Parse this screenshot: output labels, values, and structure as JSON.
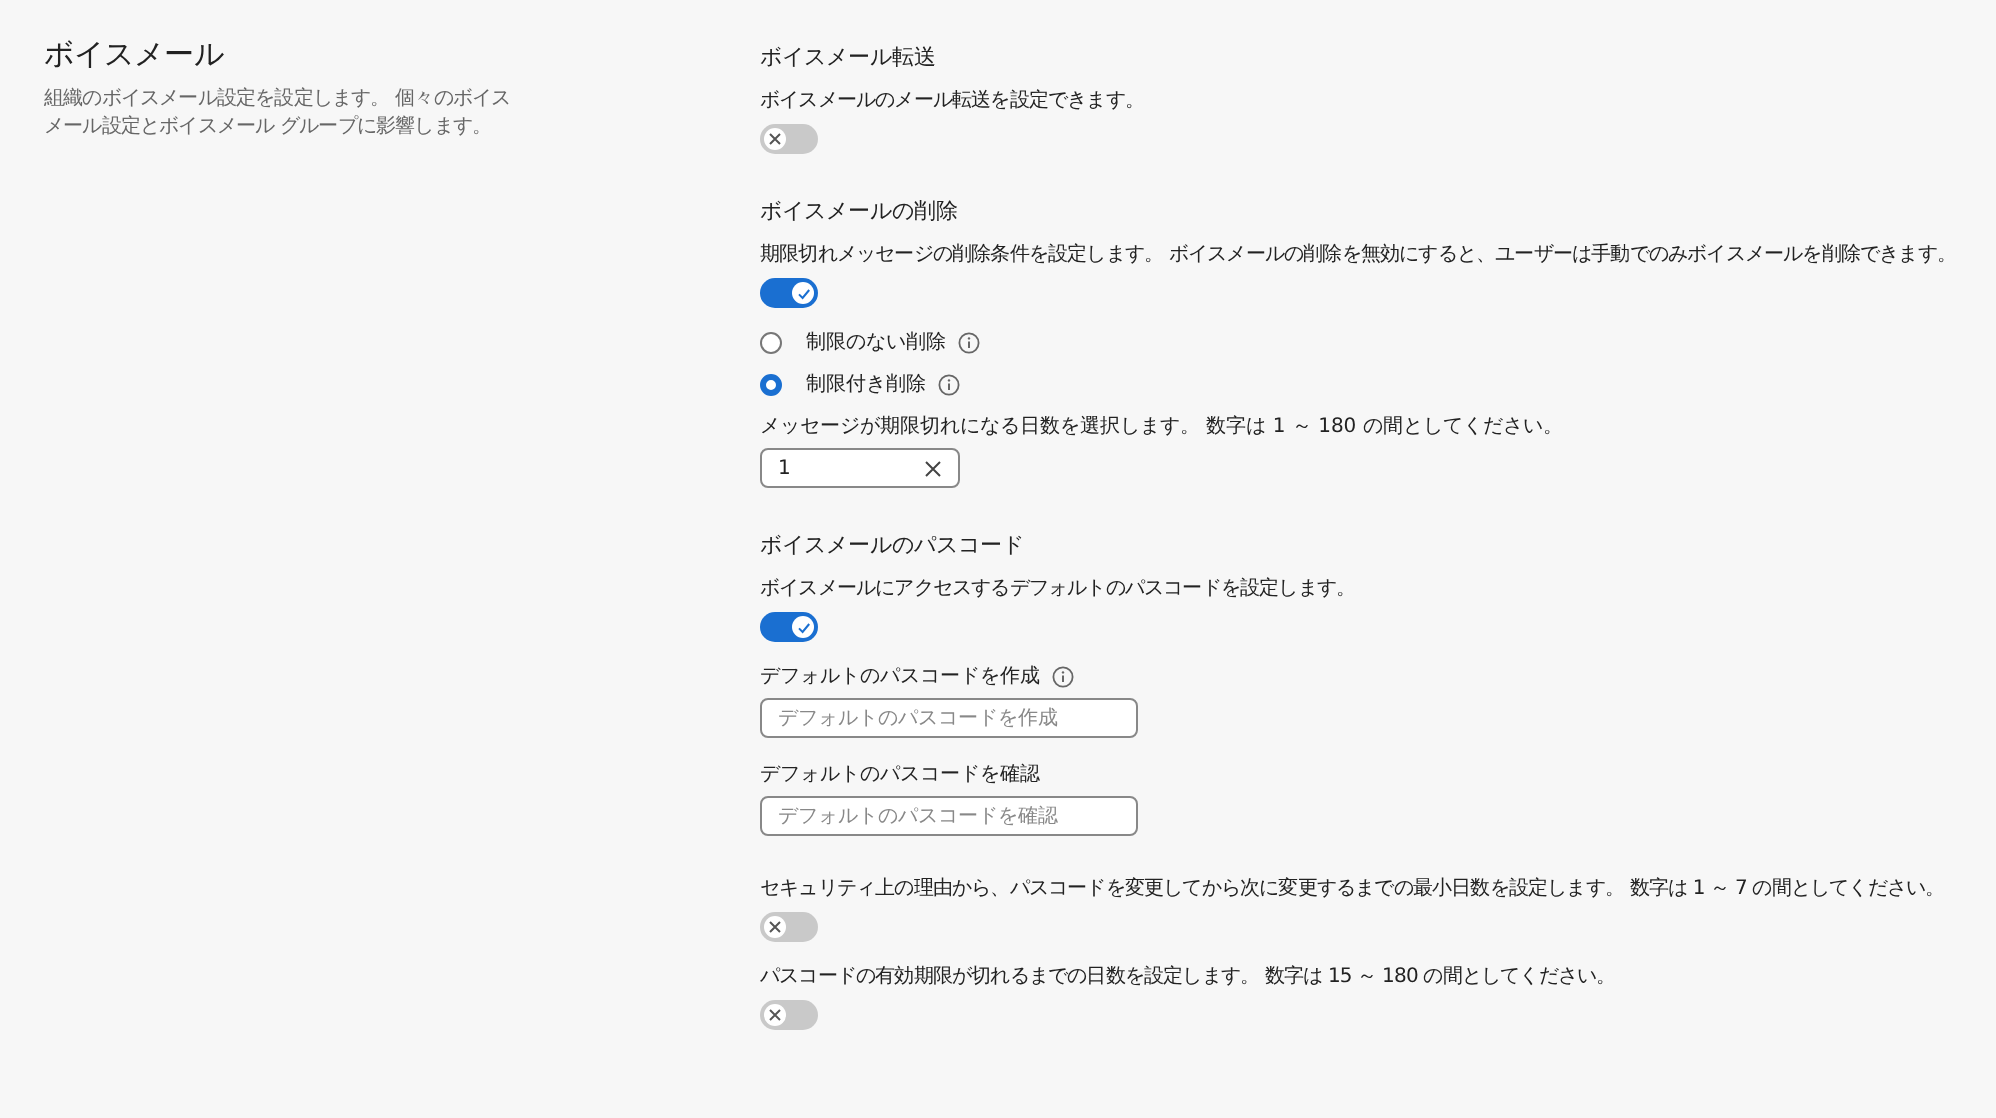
{
  "page": {
    "title": "ボイスメール",
    "description": "組織のボイスメール設定を設定します。 個々のボイスメール設定とボイスメール グループに影響します。"
  },
  "sections": [
    {
      "heading": "ボイスメール転送",
      "items": [
        {
          "kind": "text",
          "text": "ボイスメールのメール転送を設定できます。"
        },
        {
          "kind": "toggle",
          "on": false
        }
      ]
    },
    {
      "heading": "ボイスメールの削除",
      "items": [
        {
          "kind": "text",
          "text": "期限切れメッセージの削除条件を設定します。 ボイスメールの削除を無効にすると、ユーザーは手動でのみボイスメールを削除できます。"
        },
        {
          "kind": "toggle",
          "on": true
        },
        {
          "kind": "radio",
          "label": "制限のない削除",
          "selected": false,
          "info": true
        },
        {
          "kind": "radio",
          "label": "制限付き削除",
          "selected": true,
          "info": true
        },
        {
          "kind": "label",
          "text": "メッセージが期限切れになる日数を選択します。 数字は 1 ～ 180 の間としてください。",
          "info": false
        },
        {
          "kind": "input",
          "value": "1",
          "clearable": true
        }
      ]
    },
    {
      "heading": "ボイスメールのパスコード",
      "items": [
        {
          "kind": "text",
          "text": "ボイスメールにアクセスするデフォルトのパスコードを設定します。"
        },
        {
          "kind": "toggle",
          "on": true
        },
        {
          "kind": "label",
          "text": "デフォルトのパスコードを作成",
          "info": true
        },
        {
          "kind": "input",
          "placeholder": "デフォルトのパスコードを作成",
          "clearable": false
        },
        {
          "kind": "label",
          "text": "デフォルトのパスコードを確認",
          "info": false
        },
        {
          "kind": "input",
          "placeholder": "デフォルトのパスコードを確認",
          "clearable": false
        },
        {
          "kind": "text",
          "text": "セキュリティ上の理由から、パスコードを変更してから次に変更するまでの最小日数を設定します。 数字は 1 ～ 7 の間としてください。"
        },
        {
          "kind": "toggle",
          "on": false
        },
        {
          "kind": "text",
          "text": "パスコードの有効期限が切れるまでの日数を設定します。 数字は 15 ～ 180 の間としてください。"
        },
        {
          "kind": "toggle",
          "on": false
        }
      ]
    }
  ]
}
